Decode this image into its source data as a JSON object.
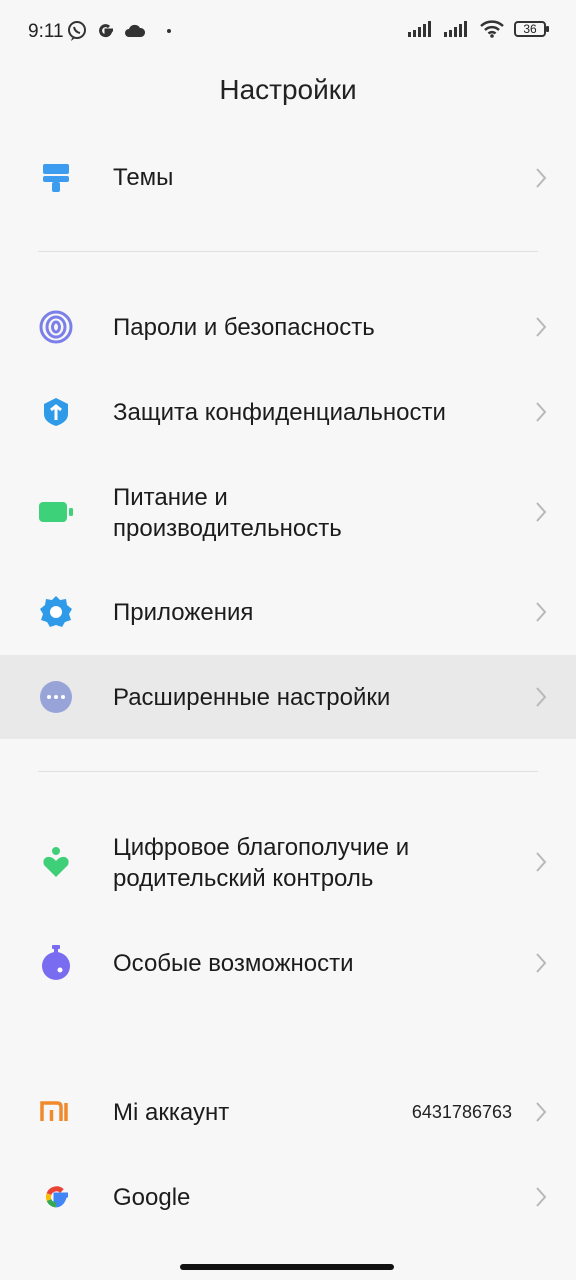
{
  "status_bar": {
    "time": "9:11",
    "left_icons": [
      "viber-icon",
      "google-g-icon",
      "cloud-icon",
      "dot-icon"
    ],
    "right_icons": [
      "signal-icon",
      "signal-icon",
      "wifi-icon"
    ],
    "battery": "36"
  },
  "page": {
    "title": "Настройки"
  },
  "items": [
    {
      "label": "Темы",
      "icon": "themes-brush-icon",
      "color": "#3b9cf0"
    },
    {
      "label": "Пароли и безопасность",
      "icon": "fingerprint-icon",
      "color": "#7b7fe8"
    },
    {
      "label": "Защита конфиденциальности",
      "icon": "privacy-shield-icon",
      "color": "#2f9be8"
    },
    {
      "label": "Питание и\nпроизводительность",
      "icon": "battery-icon",
      "color": "#3dd27a"
    },
    {
      "label": "Приложения",
      "icon": "apps-gear-icon",
      "color": "#2f9be8"
    },
    {
      "label": "Расширенные настройки",
      "icon": "more-dots-icon",
      "color": "#98a4d8"
    },
    {
      "label": "Цифровое благополучие и\nродительский контроль",
      "icon": "wellbeing-icon",
      "color": "#3fcf79"
    },
    {
      "label": "Особые возможности",
      "icon": "accessibility-icon",
      "color": "#7a6cf0"
    },
    {
      "label": "Mi аккаунт",
      "icon": "mi-logo-icon",
      "color": "#f08a2c",
      "value": "6431786763"
    },
    {
      "label": "Google",
      "icon": "google-logo-icon",
      "color": "#4285f4"
    }
  ]
}
